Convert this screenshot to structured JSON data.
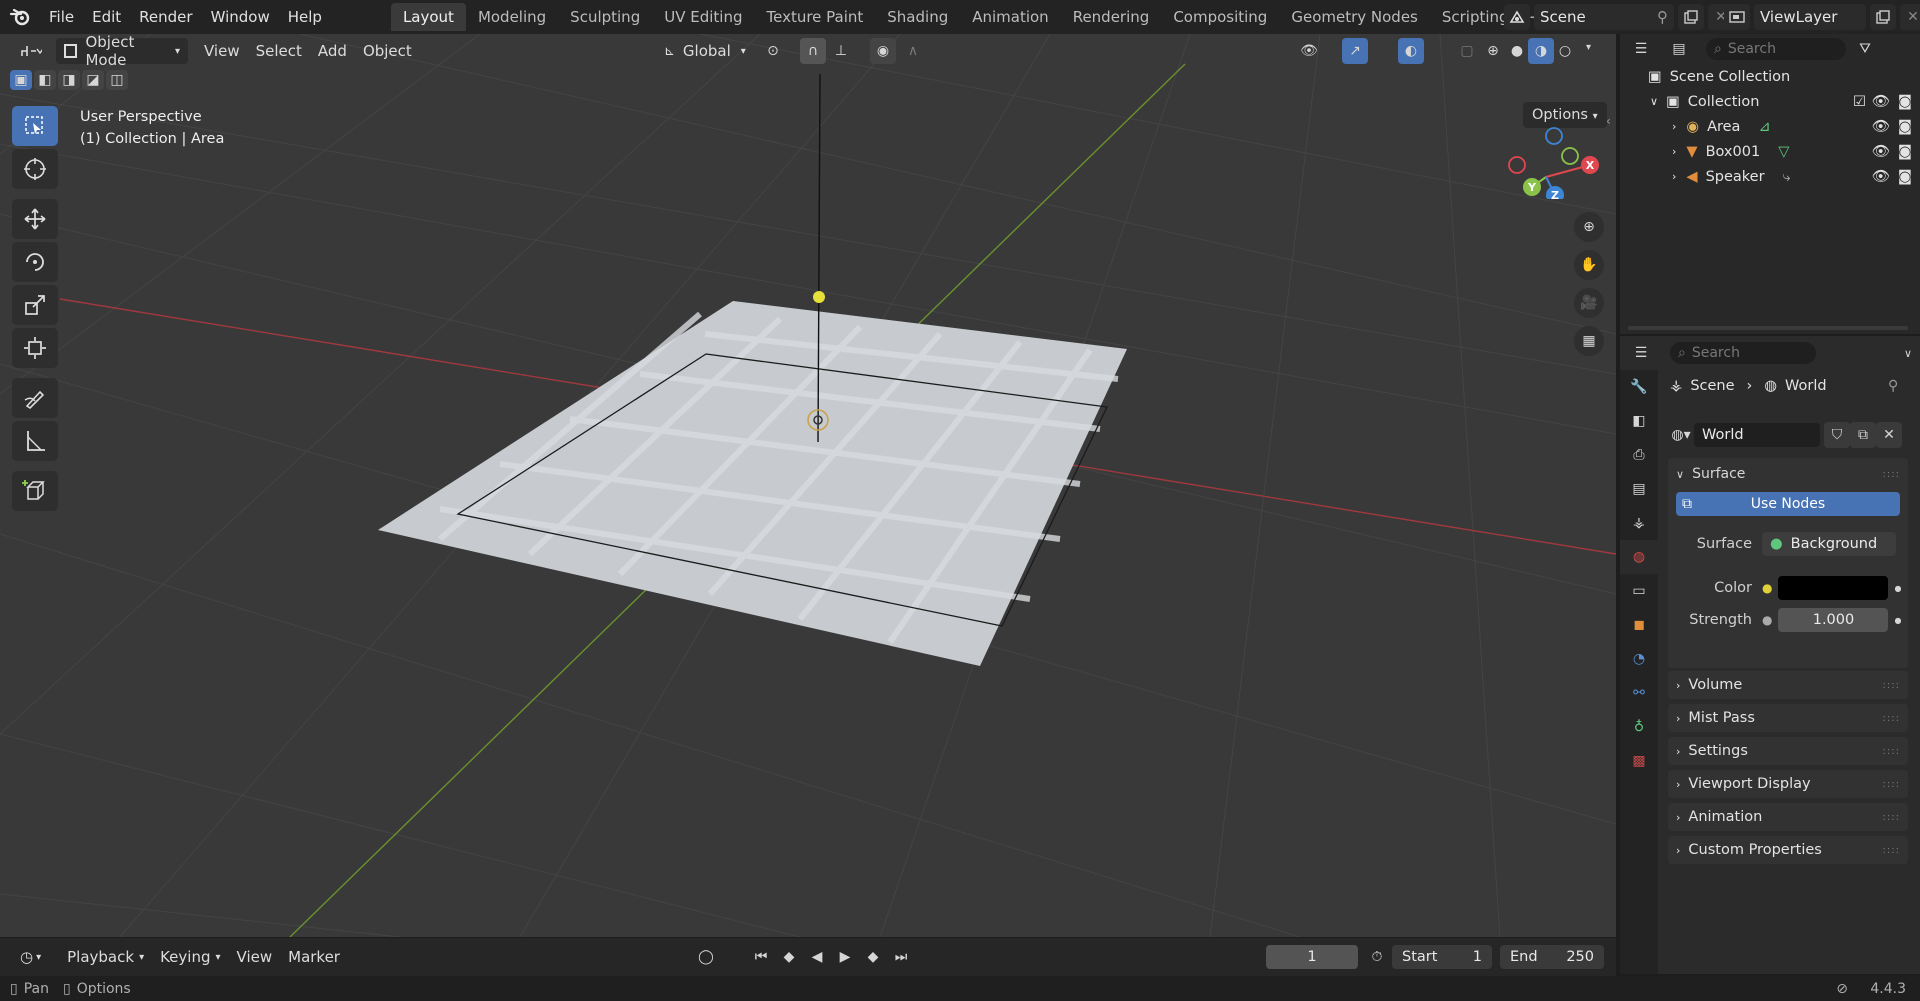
{
  "menu": {
    "items": [
      "File",
      "Edit",
      "Render",
      "Window",
      "Help"
    ]
  },
  "workspaces": {
    "tabs": [
      "Layout",
      "Modeling",
      "Sculpting",
      "UV Editing",
      "Texture Paint",
      "Shading",
      "Animation",
      "Rendering",
      "Compositing",
      "Geometry Nodes",
      "Scripting"
    ],
    "active": "Layout",
    "add": "+"
  },
  "scene": {
    "name": "Scene",
    "view_layer": "ViewLayer"
  },
  "viewport": {
    "mode": "Object Mode",
    "menus": [
      "View",
      "Select",
      "Add",
      "Object"
    ],
    "orientation": "Global",
    "info_line1": "User Perspective",
    "info_line2": "(1) Collection | Area",
    "options": "Options",
    "gizmo": {
      "x": "X",
      "y": "Y",
      "z": "Z"
    }
  },
  "timeline": {
    "menus": [
      "Playback",
      "Keying",
      "View",
      "Marker"
    ],
    "current_frame": "1",
    "start_label": "Start",
    "start": "1",
    "end_label": "End",
    "end": "250"
  },
  "statusbar": {
    "pan": "Pan",
    "options": "Options",
    "version": "4.4.3"
  },
  "outliner": {
    "search_placeholder": "Search",
    "root": "Scene Collection",
    "collection": "Collection",
    "items": [
      {
        "name": "Area",
        "icon": "light-icon"
      },
      {
        "name": "Box001",
        "icon": "mesh-icon"
      },
      {
        "name": "Speaker",
        "icon": "speaker-icon"
      }
    ]
  },
  "properties": {
    "search_placeholder": "Search",
    "breadcrumb": [
      "Scene",
      "World"
    ],
    "world_name": "World",
    "surface_panel": "Surface",
    "use_nodes": "Use Nodes",
    "surface_label": "Surface",
    "surface_value": "Background",
    "color_label": "Color",
    "color_value": "#000000",
    "strength_label": "Strength",
    "strength_value": "1.000",
    "panels": [
      "Volume",
      "Mist Pass",
      "Settings",
      "Viewport Display",
      "Animation",
      "Custom Properties"
    ]
  },
  "colors": {
    "accent": "#4772b3",
    "x_axis": "#e0474f",
    "y_axis": "#8bc34a",
    "z_axis": "#3d86d6",
    "light_yellow": "#e8e03a"
  }
}
